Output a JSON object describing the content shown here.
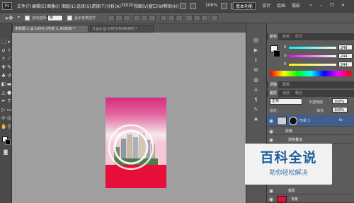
{
  "app": {
    "logo": "Ps"
  },
  "menu": [
    "文件(F)",
    "编辑(E)",
    "图像(I)",
    "图层(L)",
    "选择(S)",
    "滤镜(T)",
    "分析(A)",
    "3D(D)",
    "视图(V)",
    "窗口(W)",
    "帮助(H)"
  ],
  "zoom": "100%",
  "workspaces": [
    "基本功能",
    "设计",
    "绘画",
    "摄影"
  ],
  "options": {
    "auto_select_label": "自动选择:",
    "auto_select_value": "组",
    "show_transform_label": "显示变换控件"
  },
  "tabs": [
    "未标题-1 @ 100% (形状 1, RGB/8) *",
    "2.jpg @ 100%(RGB/8#) *"
  ],
  "color_panel": {
    "tabs": [
      "颜色",
      "色板",
      "样式"
    ],
    "channels": [
      {
        "label": "R",
        "value": "248"
      },
      {
        "label": "G",
        "value": "244"
      },
      {
        "label": "B",
        "value": "244"
      }
    ]
  },
  "adjust_tabs": [
    "调整",
    "蒙版"
  ],
  "layers_panel": {
    "tabs": [
      "图层",
      "通道",
      "路径"
    ],
    "blend_mode": "正常",
    "opacity_label": "不透明度:",
    "opacity_value": "100%",
    "lock_label": "锁定:",
    "fill_label": "填充:",
    "fill_value": "100%",
    "layers": [
      {
        "name": "形状 1",
        "fx": "fx"
      },
      {
        "name": "效果"
      },
      {
        "name": "渐变叠加"
      },
      {
        "name": "投影"
      },
      {
        "name": "背景"
      }
    ]
  },
  "watermark": {
    "title": "百科全说",
    "subtitle": "助你轻松解决"
  }
}
